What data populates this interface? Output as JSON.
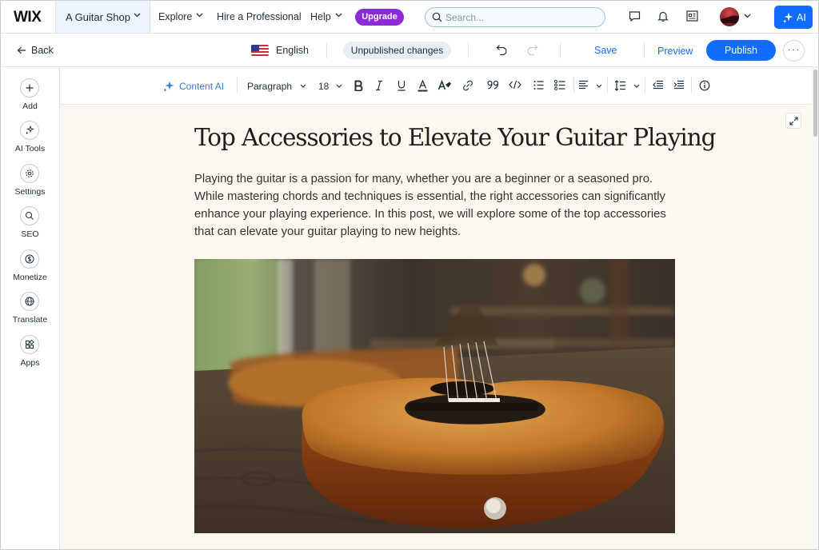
{
  "topbar": {
    "logo": "WIX",
    "site_name": "A Guitar Shop",
    "nav": {
      "explore": "Explore",
      "hire": "Hire a Professional",
      "help": "Help"
    },
    "upgrade_label": "Upgrade",
    "search_placeholder": "Search...",
    "ai_label": "AI",
    "icons": [
      "chat-icon",
      "bell-icon",
      "site-info-icon",
      "avatar",
      "chevron-down-icon"
    ]
  },
  "editbar": {
    "back_label": "Back",
    "language": "English",
    "status": "Unpublished changes",
    "save_label": "Save",
    "preview_label": "Preview",
    "publish_label": "Publish",
    "more_label": "···"
  },
  "sidebar": {
    "items": [
      {
        "label": "Add",
        "icon": "plus-icon"
      },
      {
        "label": "AI Tools",
        "icon": "sparkle-icon"
      },
      {
        "label": "Settings",
        "icon": "gear-icon"
      },
      {
        "label": "SEO",
        "icon": "search-icon"
      },
      {
        "label": "Monetize",
        "icon": "dollar-icon"
      },
      {
        "label": "Translate",
        "icon": "globe-icon"
      },
      {
        "label": "Apps",
        "icon": "apps-icon"
      }
    ]
  },
  "toolbar": {
    "content_ai": "Content AI",
    "paragraph": "Paragraph",
    "font_size": "18"
  },
  "article": {
    "title": "Top Accessories to Elevate Your Guitar Playing",
    "body": "Playing the guitar is a passion for many, whether you are a beginner or a seasoned pro. While mastering chords and techniques is essential, the right accessories can significantly enhance your playing experience. In this post, we will explore some of the top accessories that can elevate your guitar playing to new heights."
  },
  "colors": {
    "accent": "#116dff",
    "upgrade": "#8b2bd8",
    "canvas": "#fdf8ef"
  }
}
